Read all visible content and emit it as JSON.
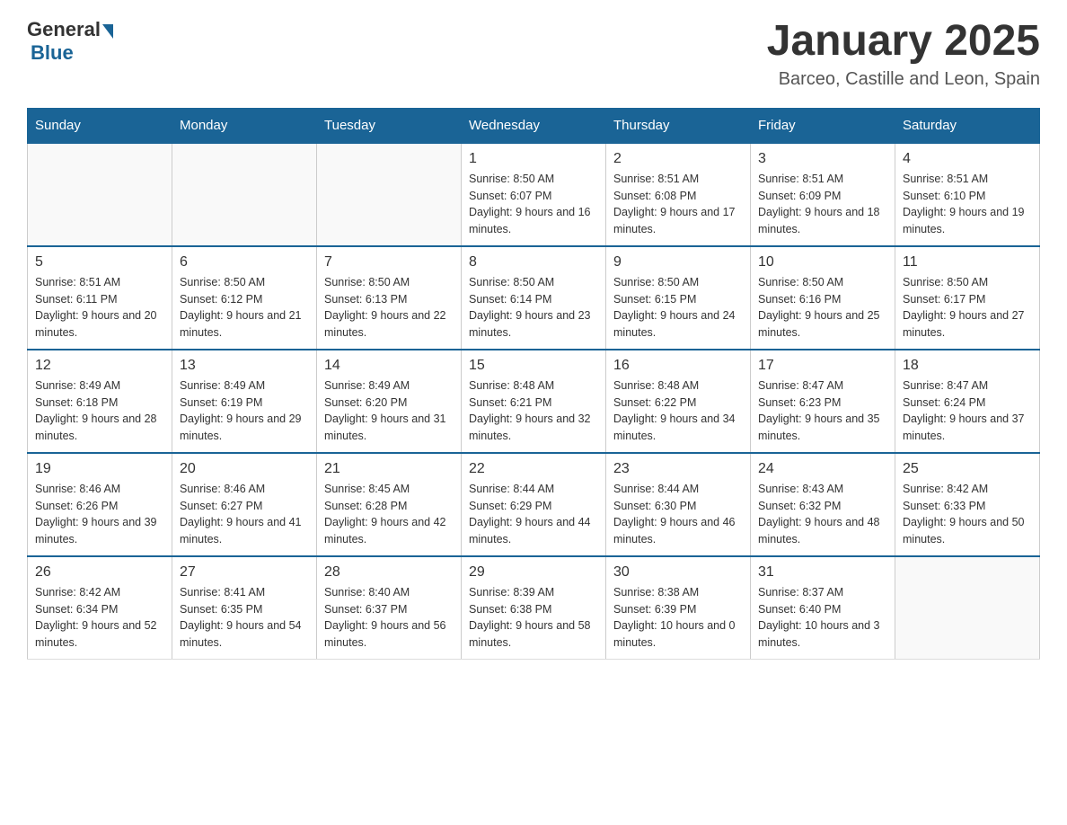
{
  "header": {
    "logo": {
      "general": "General",
      "blue": "Blue"
    },
    "title": "January 2025",
    "location": "Barceo, Castille and Leon, Spain"
  },
  "calendar": {
    "days_of_week": [
      "Sunday",
      "Monday",
      "Tuesday",
      "Wednesday",
      "Thursday",
      "Friday",
      "Saturday"
    ],
    "weeks": [
      [
        {
          "day": "",
          "info": ""
        },
        {
          "day": "",
          "info": ""
        },
        {
          "day": "",
          "info": ""
        },
        {
          "day": "1",
          "info": "Sunrise: 8:50 AM\nSunset: 6:07 PM\nDaylight: 9 hours and 16 minutes."
        },
        {
          "day": "2",
          "info": "Sunrise: 8:51 AM\nSunset: 6:08 PM\nDaylight: 9 hours and 17 minutes."
        },
        {
          "day": "3",
          "info": "Sunrise: 8:51 AM\nSunset: 6:09 PM\nDaylight: 9 hours and 18 minutes."
        },
        {
          "day": "4",
          "info": "Sunrise: 8:51 AM\nSunset: 6:10 PM\nDaylight: 9 hours and 19 minutes."
        }
      ],
      [
        {
          "day": "5",
          "info": "Sunrise: 8:51 AM\nSunset: 6:11 PM\nDaylight: 9 hours and 20 minutes."
        },
        {
          "day": "6",
          "info": "Sunrise: 8:50 AM\nSunset: 6:12 PM\nDaylight: 9 hours and 21 minutes."
        },
        {
          "day": "7",
          "info": "Sunrise: 8:50 AM\nSunset: 6:13 PM\nDaylight: 9 hours and 22 minutes."
        },
        {
          "day": "8",
          "info": "Sunrise: 8:50 AM\nSunset: 6:14 PM\nDaylight: 9 hours and 23 minutes."
        },
        {
          "day": "9",
          "info": "Sunrise: 8:50 AM\nSunset: 6:15 PM\nDaylight: 9 hours and 24 minutes."
        },
        {
          "day": "10",
          "info": "Sunrise: 8:50 AM\nSunset: 6:16 PM\nDaylight: 9 hours and 25 minutes."
        },
        {
          "day": "11",
          "info": "Sunrise: 8:50 AM\nSunset: 6:17 PM\nDaylight: 9 hours and 27 minutes."
        }
      ],
      [
        {
          "day": "12",
          "info": "Sunrise: 8:49 AM\nSunset: 6:18 PM\nDaylight: 9 hours and 28 minutes."
        },
        {
          "day": "13",
          "info": "Sunrise: 8:49 AM\nSunset: 6:19 PM\nDaylight: 9 hours and 29 minutes."
        },
        {
          "day": "14",
          "info": "Sunrise: 8:49 AM\nSunset: 6:20 PM\nDaylight: 9 hours and 31 minutes."
        },
        {
          "day": "15",
          "info": "Sunrise: 8:48 AM\nSunset: 6:21 PM\nDaylight: 9 hours and 32 minutes."
        },
        {
          "day": "16",
          "info": "Sunrise: 8:48 AM\nSunset: 6:22 PM\nDaylight: 9 hours and 34 minutes."
        },
        {
          "day": "17",
          "info": "Sunrise: 8:47 AM\nSunset: 6:23 PM\nDaylight: 9 hours and 35 minutes."
        },
        {
          "day": "18",
          "info": "Sunrise: 8:47 AM\nSunset: 6:24 PM\nDaylight: 9 hours and 37 minutes."
        }
      ],
      [
        {
          "day": "19",
          "info": "Sunrise: 8:46 AM\nSunset: 6:26 PM\nDaylight: 9 hours and 39 minutes."
        },
        {
          "day": "20",
          "info": "Sunrise: 8:46 AM\nSunset: 6:27 PM\nDaylight: 9 hours and 41 minutes."
        },
        {
          "day": "21",
          "info": "Sunrise: 8:45 AM\nSunset: 6:28 PM\nDaylight: 9 hours and 42 minutes."
        },
        {
          "day": "22",
          "info": "Sunrise: 8:44 AM\nSunset: 6:29 PM\nDaylight: 9 hours and 44 minutes."
        },
        {
          "day": "23",
          "info": "Sunrise: 8:44 AM\nSunset: 6:30 PM\nDaylight: 9 hours and 46 minutes."
        },
        {
          "day": "24",
          "info": "Sunrise: 8:43 AM\nSunset: 6:32 PM\nDaylight: 9 hours and 48 minutes."
        },
        {
          "day": "25",
          "info": "Sunrise: 8:42 AM\nSunset: 6:33 PM\nDaylight: 9 hours and 50 minutes."
        }
      ],
      [
        {
          "day": "26",
          "info": "Sunrise: 8:42 AM\nSunset: 6:34 PM\nDaylight: 9 hours and 52 minutes."
        },
        {
          "day": "27",
          "info": "Sunrise: 8:41 AM\nSunset: 6:35 PM\nDaylight: 9 hours and 54 minutes."
        },
        {
          "day": "28",
          "info": "Sunrise: 8:40 AM\nSunset: 6:37 PM\nDaylight: 9 hours and 56 minutes."
        },
        {
          "day": "29",
          "info": "Sunrise: 8:39 AM\nSunset: 6:38 PM\nDaylight: 9 hours and 58 minutes."
        },
        {
          "day": "30",
          "info": "Sunrise: 8:38 AM\nSunset: 6:39 PM\nDaylight: 10 hours and 0 minutes."
        },
        {
          "day": "31",
          "info": "Sunrise: 8:37 AM\nSunset: 6:40 PM\nDaylight: 10 hours and 3 minutes."
        },
        {
          "day": "",
          "info": ""
        }
      ]
    ]
  }
}
